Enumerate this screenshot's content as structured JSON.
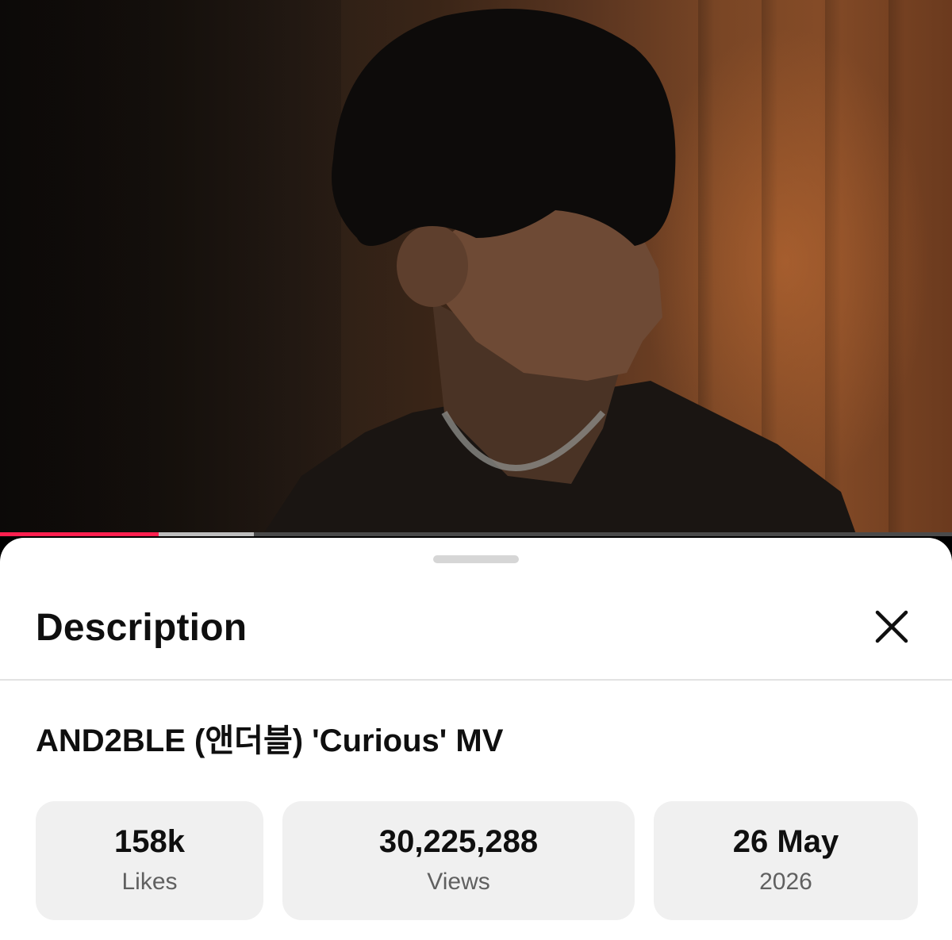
{
  "player": {
    "progress_played": 0.167,
    "progress_buffered": 0.267,
    "colors": {
      "played": "#ff1f4f",
      "buffered": "#bdbdbd",
      "track": "#4a4a4a"
    }
  },
  "sheet": {
    "title": "Description",
    "close_icon": "close-icon"
  },
  "video": {
    "title": "AND2BLE (앤더블) 'Curious' MV"
  },
  "stats": [
    {
      "value": "158k",
      "label": "Likes"
    },
    {
      "value": "30,225,288",
      "label": "Views"
    },
    {
      "value": "26 May",
      "label": "2026"
    }
  ]
}
